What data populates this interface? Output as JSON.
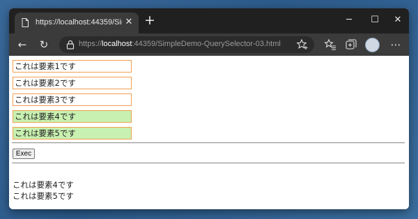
{
  "browser": {
    "tab_title": "https://localhost:44359/SimpleDemo-QuerySelector-03.html",
    "tab_close": "✕",
    "new_tab": "+",
    "address_scheme": "https://",
    "address_host": "localhost",
    "address_rest": ":44359/SimpleDemo-QuerySelector-03.html",
    "window_controls": {
      "minimize": "─",
      "maximize": "☐",
      "close": "✕"
    },
    "toolbar": {
      "back": "←",
      "refresh": "↻",
      "more": "⋯"
    }
  },
  "page": {
    "elements": [
      {
        "text": "これは要素1です",
        "selected": false
      },
      {
        "text": "これは要素2です",
        "selected": false
      },
      {
        "text": "これは要素3です",
        "selected": false
      },
      {
        "text": "これは要素4です",
        "selected": true
      },
      {
        "text": "これは要素5です",
        "selected": true
      }
    ],
    "exec_label": "Exec",
    "results": [
      "これは要素4です",
      "これは要素5です"
    ]
  },
  "colors": {
    "box_border": "#f0a050",
    "selected_bg": "#c8f0b0",
    "titlebar_bg": "#202020",
    "toolbar_bg": "#3b3b3b"
  }
}
